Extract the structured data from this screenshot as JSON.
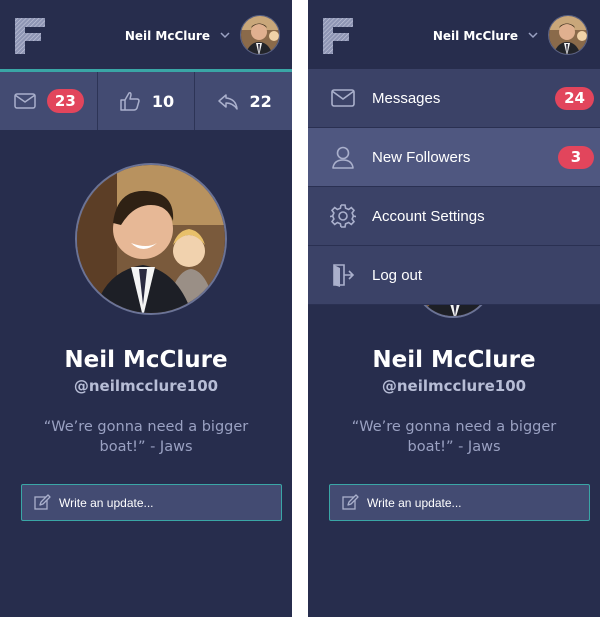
{
  "left_screen": {
    "header": {
      "user_name": "Neil McClure"
    },
    "stats": [
      {
        "icon": "envelope-icon",
        "value": "23",
        "is_badge": true
      },
      {
        "icon": "thumbs-up-icon",
        "value": "10",
        "is_badge": false
      },
      {
        "icon": "reply-icon",
        "value": "22",
        "is_badge": false
      }
    ],
    "profile": {
      "name": "Neil McClure",
      "handle": "@neilmcclure100",
      "quote": "“We’re gonna need a bigger boat!” - Jaws"
    },
    "update": {
      "placeholder": "Write an update..."
    }
  },
  "right_screen": {
    "header": {
      "user_name": "Neil McClure"
    },
    "menu": [
      {
        "icon": "envelope-icon",
        "label": "Messages",
        "badge": "24",
        "active": false
      },
      {
        "icon": "user-icon",
        "label": "New Followers",
        "badge": "3",
        "active": true
      },
      {
        "icon": "gear-icon",
        "label": "Account Settings",
        "badge": "",
        "active": false
      },
      {
        "icon": "logout-icon",
        "label": "Log out",
        "badge": "",
        "active": false
      }
    ],
    "profile": {
      "name": "Neil McClure",
      "handle": "@neilmcclure100",
      "quote": "“We’re gonna need a bigger boat!” - Jaws"
    },
    "update": {
      "placeholder": "Write an update..."
    }
  },
  "colors": {
    "background": "#272d4d",
    "panel": "#434b72",
    "accent_teal": "#3aa6a6",
    "badge_red": "#e2455c",
    "menu_item": "#3b4267",
    "menu_item_active": "#4f5780"
  }
}
